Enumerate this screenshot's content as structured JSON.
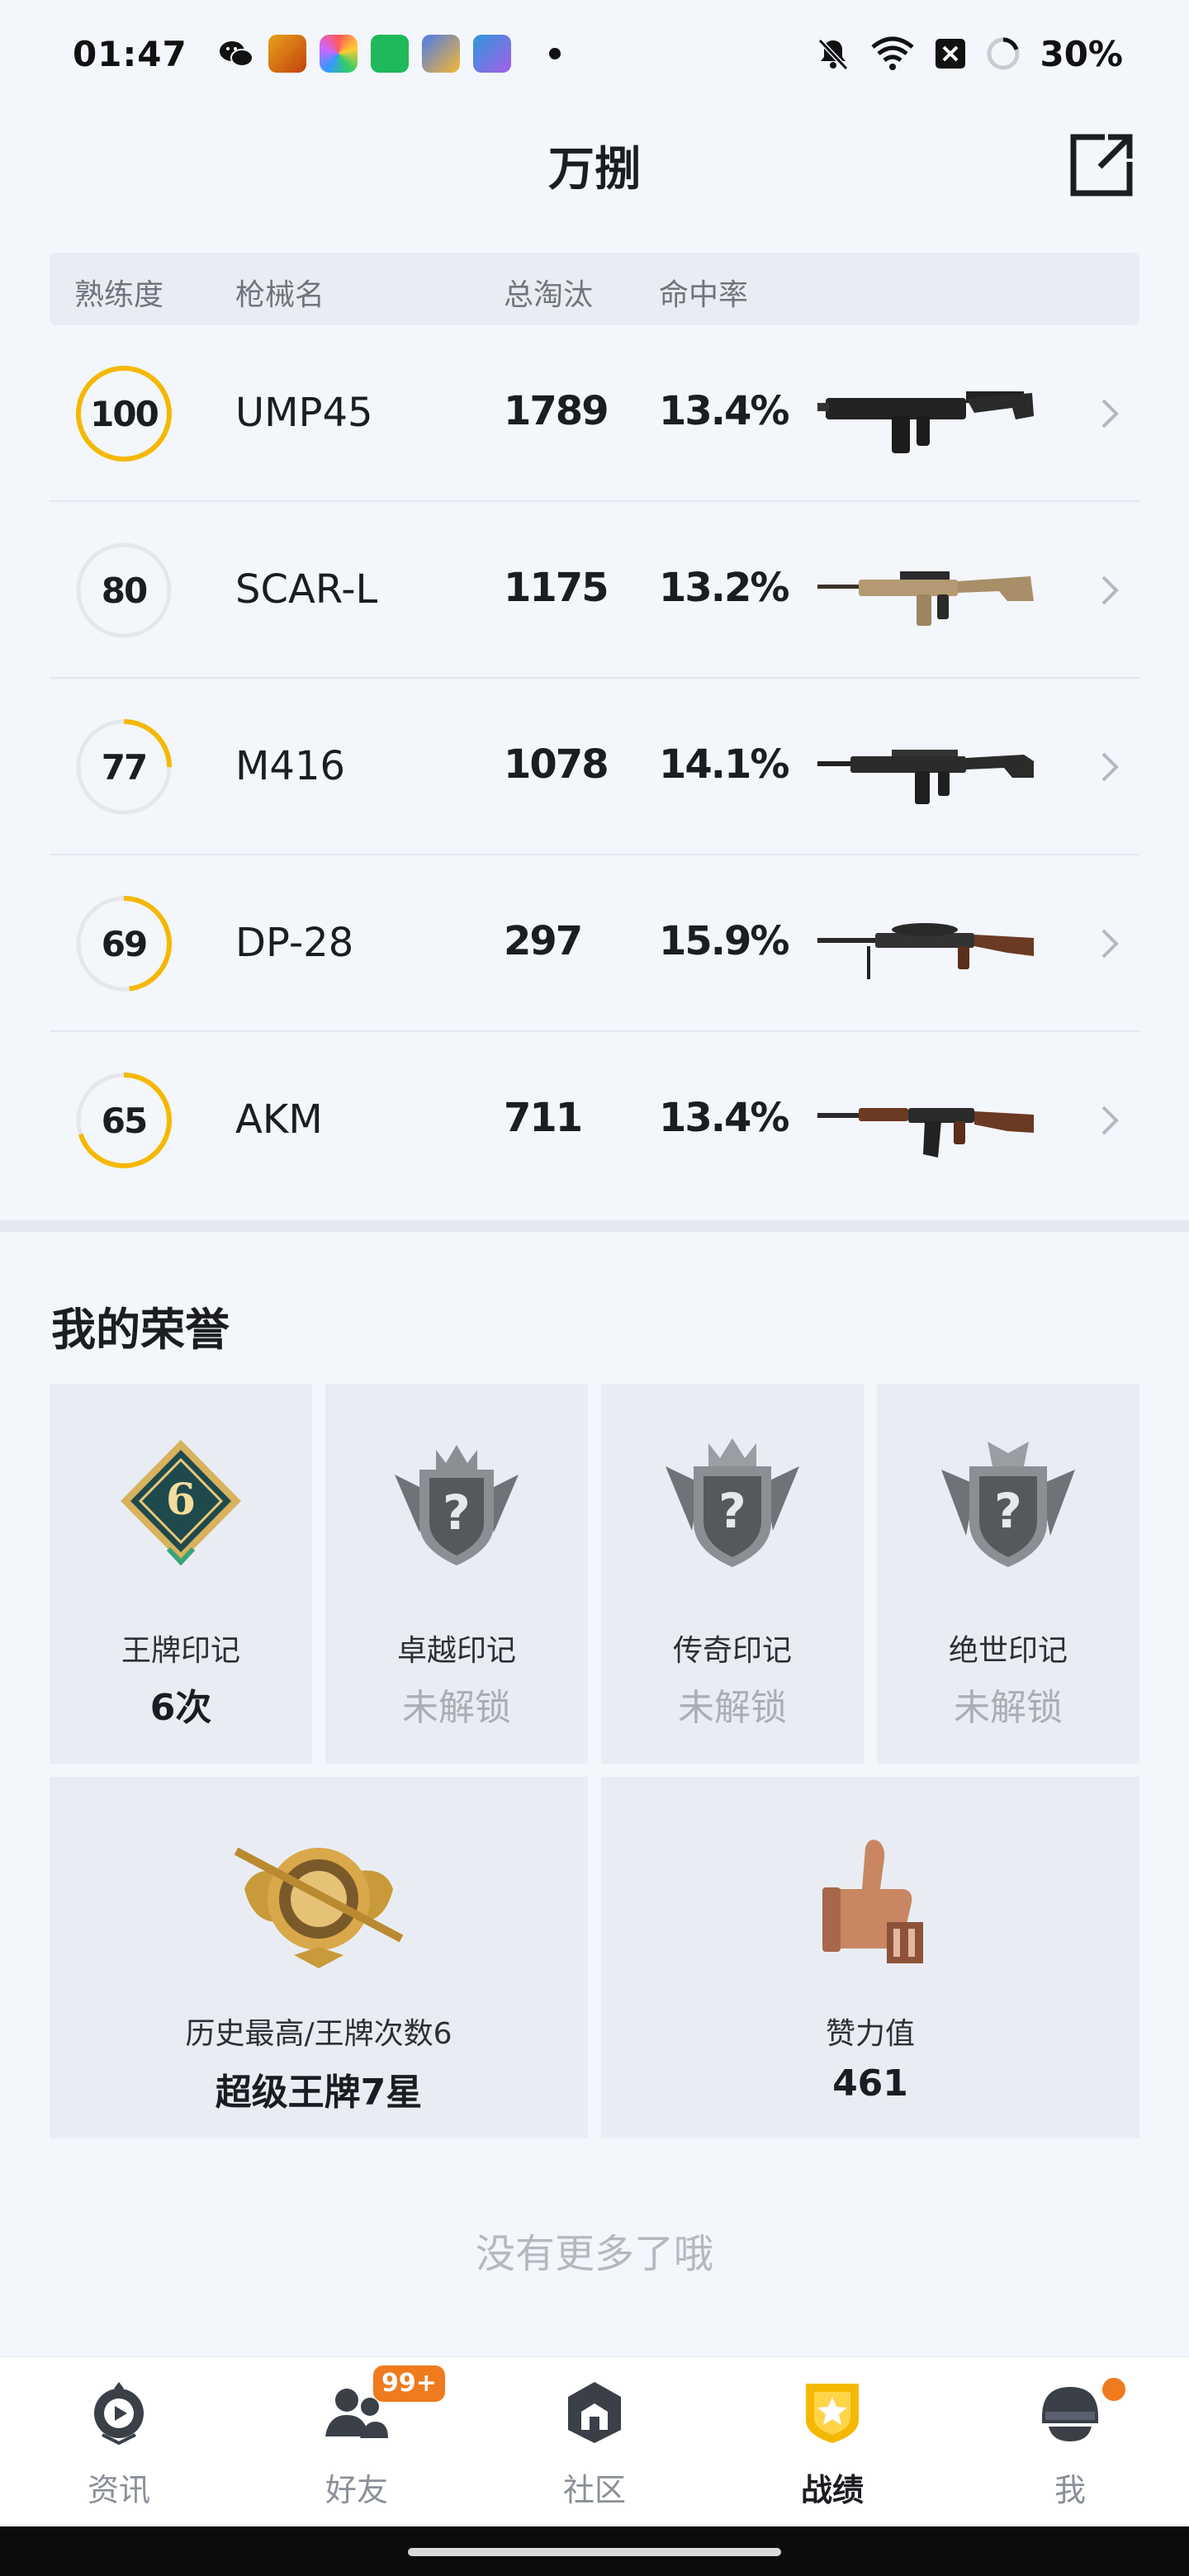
{
  "status_bar": {
    "time": "01:47",
    "battery": "30%",
    "icons": [
      "wechat-icon",
      "game-app-icon",
      "colorful-app-icon",
      "security-app-icon",
      "game-app-2-icon",
      "game-app-3-icon",
      "mute-icon",
      "wifi-icon",
      "sim-off-icon",
      "battery-ring-icon"
    ]
  },
  "header": {
    "title": "万捌",
    "share_icon": "share-external-icon"
  },
  "table": {
    "columns": [
      "熟练度",
      "枪械名",
      "总淘汰",
      "命中率"
    ],
    "rows": [
      {
        "proficiency": "100",
        "progress": 1.0,
        "name": "UMP45",
        "kills": "1789",
        "accuracy": "13.4%",
        "image": "ump45-smg"
      },
      {
        "proficiency": "80",
        "progress": 0.0,
        "name": "SCAR-L",
        "kills": "1175",
        "accuracy": "13.2%",
        "image": "scar-l-rifle"
      },
      {
        "proficiency": "77",
        "progress": 0.25,
        "name": "M416",
        "kills": "1078",
        "accuracy": "14.1%",
        "image": "m416-rifle"
      },
      {
        "proficiency": "69",
        "progress": 0.48,
        "name": "DP-28",
        "kills": "297",
        "accuracy": "15.9%",
        "image": "dp28-lmg"
      },
      {
        "proficiency": "65",
        "progress": 0.7,
        "name": "AKM",
        "kills": "711",
        "accuracy": "13.4%",
        "image": "akm-rifle"
      }
    ]
  },
  "honors": {
    "title": "我的荣誉",
    "marks": [
      {
        "label": "王牌印记",
        "value": "6次",
        "locked": false,
        "badge_digit": "6",
        "icon": "ace-mark-badge-icon"
      },
      {
        "label": "卓越印记",
        "value": "未解锁",
        "locked": true,
        "icon": "excellence-mark-badge-icon"
      },
      {
        "label": "传奇印记",
        "value": "未解锁",
        "locked": true,
        "icon": "legend-mark-badge-icon"
      },
      {
        "label": "绝世印记",
        "value": "未解锁",
        "locked": true,
        "icon": "peerless-mark-badge-icon"
      }
    ],
    "stats": [
      {
        "label": "历史最高/王牌次数6",
        "value": "超级王牌7星",
        "icon": "super-ace-badge-icon"
      },
      {
        "label": "赞力值",
        "value": "461",
        "icon": "thumbs-up-trophy-icon"
      }
    ]
  },
  "footer_text": "没有更多了哦",
  "bottom_nav": {
    "items": [
      {
        "label": "资讯",
        "icon": "news-play-icon",
        "active": false
      },
      {
        "label": "好友",
        "icon": "friends-icon",
        "active": false,
        "badge": "99+"
      },
      {
        "label": "社区",
        "icon": "community-house-icon",
        "active": false
      },
      {
        "label": "战绩",
        "icon": "record-shield-icon",
        "active": true
      },
      {
        "label": "我",
        "icon": "helmet-profile-icon",
        "active": false,
        "dot": true
      }
    ]
  },
  "colors": {
    "accent": "#f5b800",
    "badge_orange": "#f07a1e",
    "background": "#f3f6fb",
    "card": "#e9edf3"
  }
}
